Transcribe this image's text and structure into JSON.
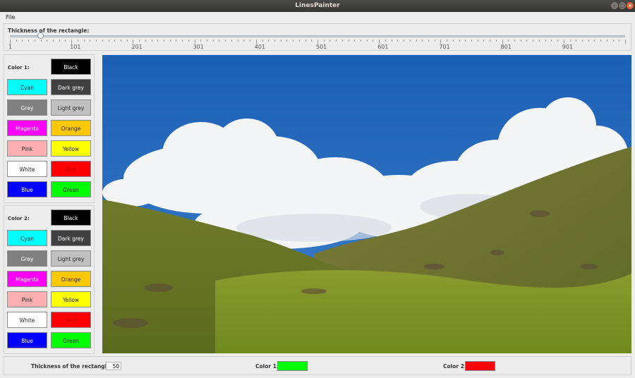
{
  "window": {
    "title": "LinesPainter"
  },
  "menu": {
    "items": [
      "File"
    ]
  },
  "slider": {
    "label": "Thickness of the rectangle:",
    "min": 1,
    "max": 1000,
    "value": 50,
    "tick_labels": [
      "1",
      "101",
      "201",
      "301",
      "401",
      "501",
      "601",
      "701",
      "801",
      "901"
    ]
  },
  "color_panel_1": {
    "label": "Color 1:",
    "buttons": [
      {
        "label": "Black",
        "color": "#000000"
      },
      {
        "label": "Cyan",
        "color": "#00ffff"
      },
      {
        "label": "Dark grey",
        "color": "#404040"
      },
      {
        "label": "Grey",
        "color": "#808080"
      },
      {
        "label": "Light grey",
        "color": "#c0c0c0"
      },
      {
        "label": "Magenta",
        "color": "#ff00ff"
      },
      {
        "label": "Orange",
        "color": "#ffc800"
      },
      {
        "label": "Pink",
        "color": "#ffafaf"
      },
      {
        "label": "Yellow",
        "color": "#ffff00"
      },
      {
        "label": "White",
        "color": "#ffffff"
      },
      {
        "label": "Red",
        "color": "#ff0000"
      },
      {
        "label": "Blue",
        "color": "#0000ff"
      },
      {
        "label": "Green",
        "color": "#00ff00"
      }
    ]
  },
  "color_panel_2": {
    "label": "Color 2:",
    "buttons": [
      {
        "label": "Black",
        "color": "#000000"
      },
      {
        "label": "Cyan",
        "color": "#00ffff"
      },
      {
        "label": "Dark grey",
        "color": "#404040"
      },
      {
        "label": "Grey",
        "color": "#808080"
      },
      {
        "label": "Light grey",
        "color": "#c0c0c0"
      },
      {
        "label": "Magenta",
        "color": "#ff00ff"
      },
      {
        "label": "Orange",
        "color": "#ffc800"
      },
      {
        "label": "Pink",
        "color": "#ffafaf"
      },
      {
        "label": "Yellow",
        "color": "#ffff00"
      },
      {
        "label": "White",
        "color": "#ffffff"
      },
      {
        "label": "Red",
        "color": "#ff0000"
      },
      {
        "label": "Blue",
        "color": "#0000ff"
      },
      {
        "label": "Green",
        "color": "#00ff00"
      }
    ]
  },
  "status": {
    "thickness_label": "Thickness of the rectangle:",
    "thickness_value": "50",
    "color1_label": "Color 1:",
    "color1": "#00ff00",
    "color2_label": "Color 2:",
    "color2": "#ff0000"
  }
}
